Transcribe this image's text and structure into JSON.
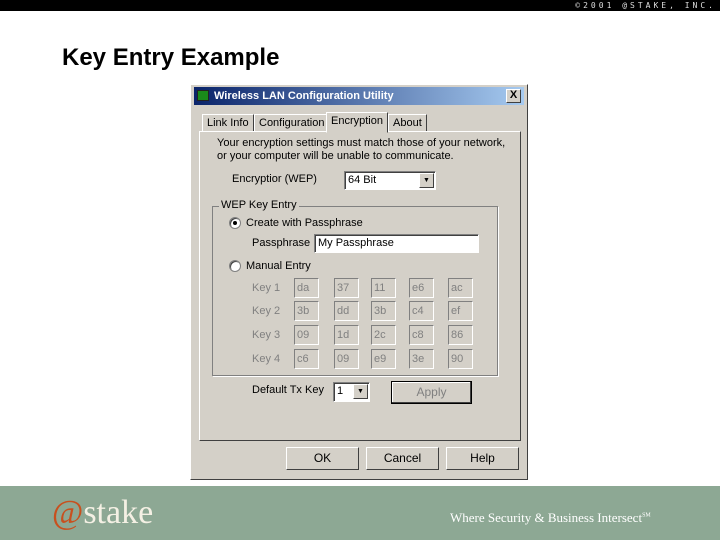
{
  "header": {
    "copyright": "©2001 @STAKE, INC.",
    "title": "Key Entry Example"
  },
  "dialog": {
    "title": "Wireless LAN Configuration Utility",
    "close": "X",
    "tabs": [
      {
        "label": "Link Info"
      },
      {
        "label": "Configuration"
      },
      {
        "label": "Encryption",
        "active": true
      },
      {
        "label": "About"
      }
    ],
    "notice_line1": "Your encryption settings must match those of your network,",
    "notice_line2": "or your computer will be unable to communicate.",
    "encryption_label": "Encryptior (WEP)",
    "encryption_value": "64 Bit",
    "group_label": "WEP Key Entry",
    "radio_passphrase": "Create with Passphrase",
    "passphrase_label": "Passphrase",
    "passphrase_value": "My Passphrase",
    "radio_manual": "Manual Entry",
    "selected_mode": "passphrase",
    "keys": [
      {
        "label": "Key 1",
        "bytes": [
          "da",
          "37",
          "11",
          "e6",
          "ac"
        ]
      },
      {
        "label": "Key 2",
        "bytes": [
          "3b",
          "dd",
          "3b",
          "c4",
          "ef"
        ]
      },
      {
        "label": "Key 3",
        "bytes": [
          "09",
          "1d",
          "2c",
          "c8",
          "86"
        ]
      },
      {
        "label": "Key 4",
        "bytes": [
          "c6",
          "09",
          "e9",
          "3e",
          "90"
        ]
      }
    ],
    "default_tx_label": "Default Tx Key",
    "default_tx_value": "1",
    "apply": "Apply",
    "ok": "OK",
    "cancel": "Cancel",
    "help": "Help"
  },
  "footer": {
    "logo_at": "@",
    "logo_text": "stake",
    "tagline": "Where Security & Business Intersect",
    "tagline_mark": "SM"
  },
  "colors": {
    "footer": "#8da894",
    "logo_accent": "#c8501e",
    "titlebar": "#0a246a"
  }
}
